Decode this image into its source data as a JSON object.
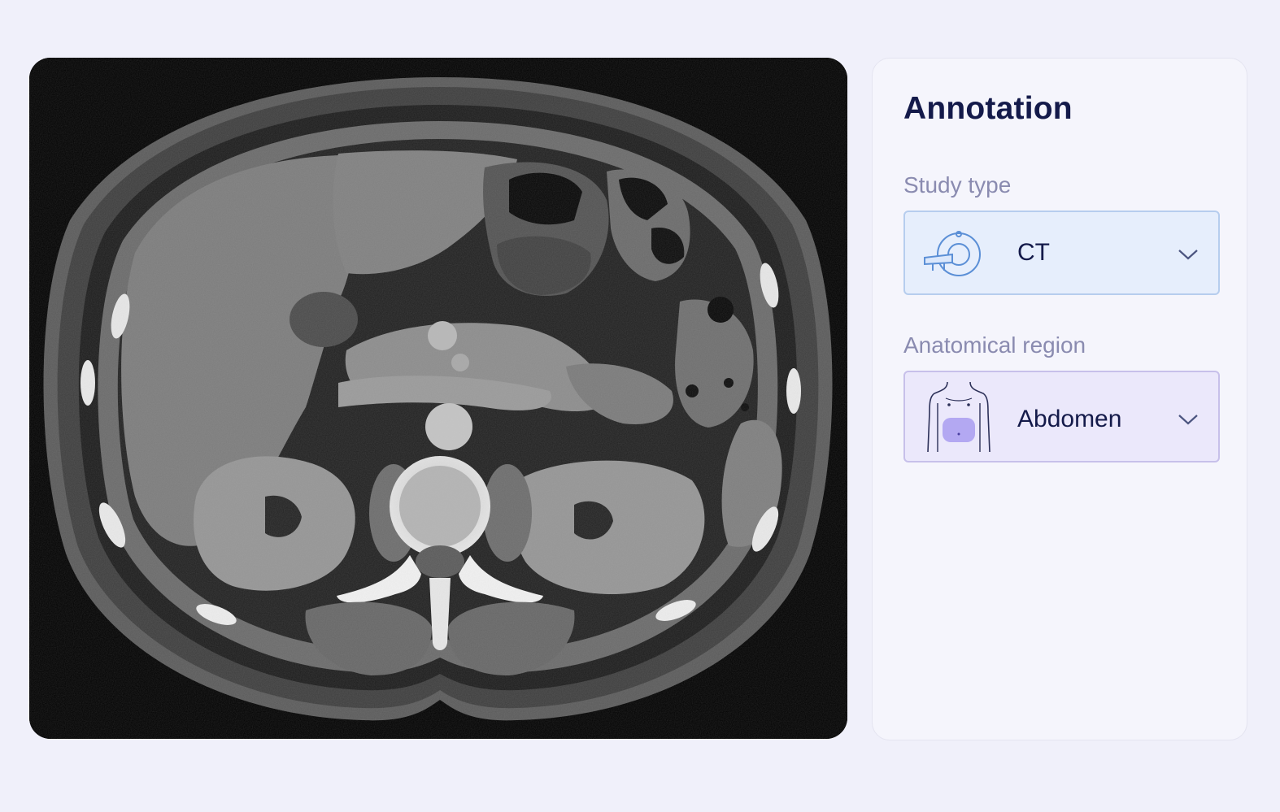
{
  "viewer": {
    "image_alt": "Axial abdominal CT slice"
  },
  "annotation": {
    "title": "Annotation",
    "study_type": {
      "label": "Study type",
      "value": "CT",
      "icon": "ct-scanner-icon"
    },
    "region": {
      "label": "Anatomical region",
      "value": "Abdomen",
      "icon": "torso-abdomen-icon"
    }
  },
  "colors": {
    "study_select_bg": "#e6eefc",
    "region_select_bg": "#ebe8fb",
    "title": "#141a4a",
    "label": "#8a8bb0"
  }
}
